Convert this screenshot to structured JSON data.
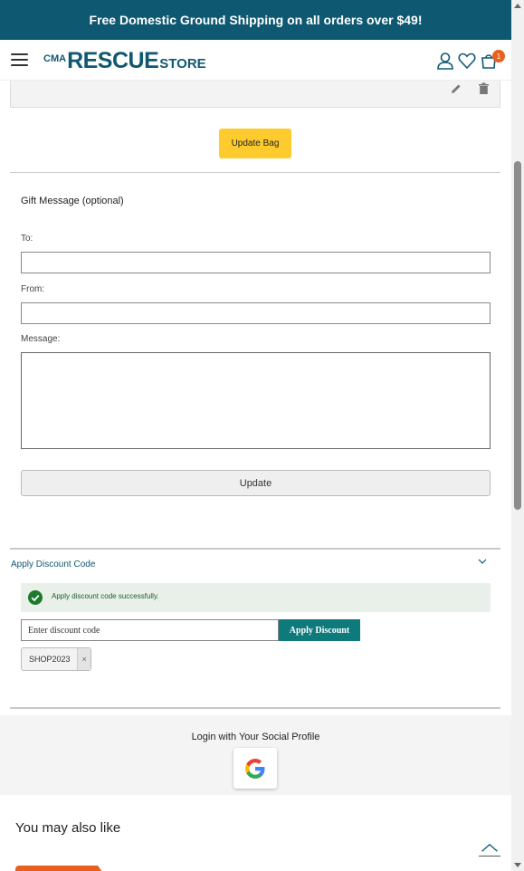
{
  "promo": {
    "text": "Free Domestic Ground Shipping on all orders over $49!"
  },
  "header": {
    "logo": {
      "cma": "CMA",
      "rescue": "RESCUE",
      "store": "STORE"
    },
    "cart_count": "1",
    "icons": [
      "menu-icon",
      "user-icon",
      "heart-icon",
      "bag-icon"
    ]
  },
  "cart": {
    "update_bag_label": "Update Bag"
  },
  "gift": {
    "title": "Gift Message (optional)",
    "to_label": "To:",
    "to_value": "",
    "from_label": "From:",
    "from_value": "",
    "message_label": "Message:",
    "message_value": "",
    "update_label": "Update"
  },
  "discount": {
    "title": "Apply Discount Code",
    "success_message": "Apply discount code successfully.",
    "code_placeholder": "Enter discount code",
    "apply_label": "Apply Discount",
    "applied_code": "SHOP2023",
    "remove_label": "×"
  },
  "social": {
    "title": "Login with Your Social Profile"
  },
  "also": {
    "title": "You may also like"
  },
  "colors": {
    "brand": "#0f5872",
    "accent_yellow": "#fecb2f",
    "teal_button": "#0f7a7c",
    "badge_orange": "#e8601c",
    "success_bg": "#e8f0e9"
  }
}
